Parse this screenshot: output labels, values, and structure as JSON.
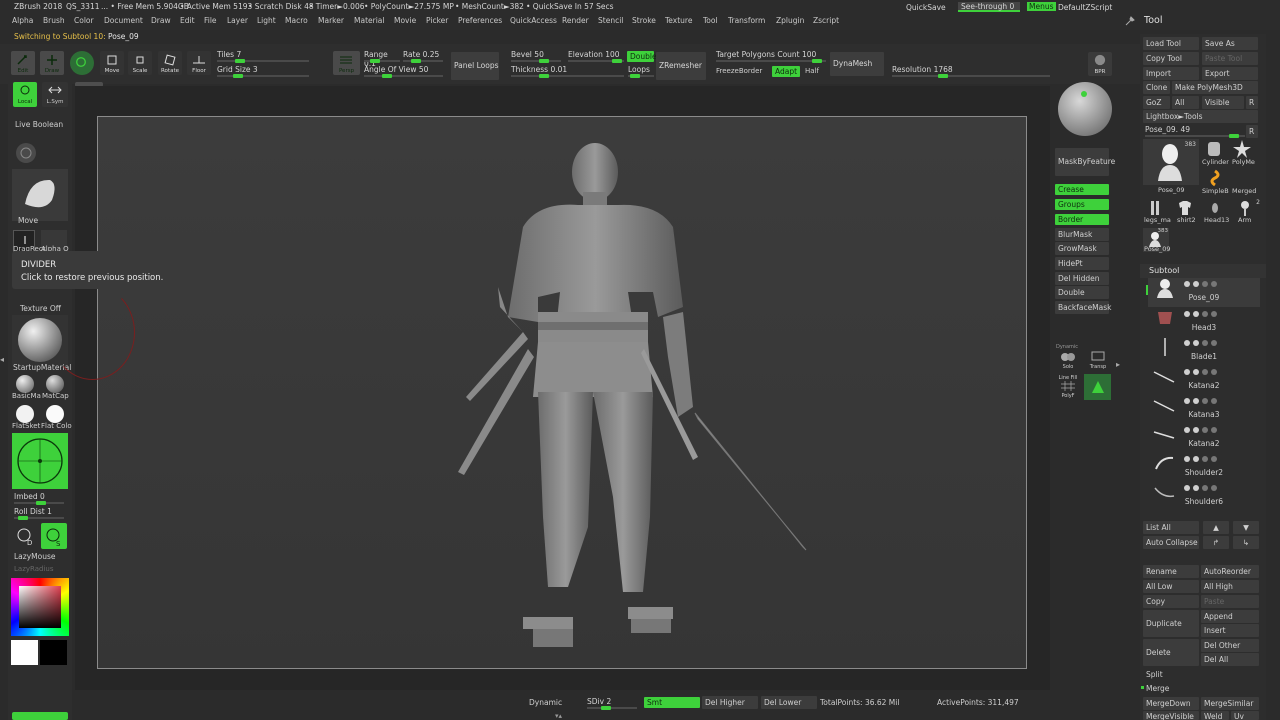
{
  "titlebar": {
    "app": "ZBrush 2018",
    "file": "QS_3311",
    "free_mem": "... • Free Mem 5.904GB",
    "active_mem": "• Active Mem 5193",
    "scratch": "• Scratch Disk 48",
    "timer": "• Timer►0.006",
    "polycount": "• PolyCount►27.575 MP",
    "meshcount": "• MeshCount►382",
    "quicksave_in": "• QuickSave In 57 Secs",
    "quicksave": "QuickSave",
    "see_through": "See-through  0",
    "menus": "Menus",
    "script": "DefaultZScript"
  },
  "menubar": [
    "Alpha",
    "Brush",
    "Color",
    "Document",
    "Draw",
    "Edit",
    "File",
    "Layer",
    "Light",
    "Macro",
    "Marker",
    "Material",
    "Movie",
    "Picker",
    "Preferences",
    "QuickAccess",
    "Render",
    "Stencil",
    "Stroke",
    "Texture",
    "Tool",
    "Transform",
    "Zplugin",
    "Zscript"
  ],
  "status": {
    "prefix": "Switching to Subtool 10:",
    "name": "Pose_09"
  },
  "toolbar": {
    "edit": "Edit",
    "draw": "Draw",
    "move": "Move",
    "scale": "Scale",
    "rotate": "Rotate",
    "floor": "Floor",
    "tiles_label": "Tiles",
    "tiles_val": "7",
    "grid_label": "Grid Size",
    "grid_val": "3",
    "persp": "Persp",
    "range_label": "Range",
    "range_val": "0.1",
    "rate_label": "Rate",
    "rate_val": "0.25",
    "angle_label": "Angle Of View",
    "angle_val": "50",
    "panel_loops": "Panel Loops",
    "bevel_label": "Bevel",
    "bevel_val": "50",
    "elevation_label": "Elevation",
    "elevation_val": "100",
    "double": "Double",
    "thickness_label": "Thickness",
    "thickness_val": "0.01",
    "loops": "Loops",
    "zremesher": "ZRemesher",
    "target_label": "Target Polygons Count",
    "target_val": "100",
    "freeze": "FreezeBorder",
    "adapt": "Adapt",
    "half": "Half",
    "dynamesh": "DynaMesh",
    "resolution_label": "Resolution",
    "resolution_val": "1768",
    "bpr": "BPR"
  },
  "left": {
    "local": "Local",
    "lsym": "L.Sym",
    "live_boolean": "Live Boolean",
    "move": "Move",
    "dragrect": "DragRect",
    "alpha": "Alpha O",
    "texture": "Texture Off",
    "startup_material": "StartupMaterial",
    "basic": "BasicMa",
    "matcap": "MatCap",
    "flat": "FlatSket",
    "flatcol": "Flat Colo",
    "imbed_label": "Imbed",
    "imbed_val": "0",
    "roll_label": "Roll Dist",
    "roll_val": "1",
    "lazymouse": "LazyMouse",
    "lazyradius": "LazyRadius"
  },
  "tooltip": {
    "title": "DIVIDER",
    "text": "Click to restore previous position."
  },
  "midright": {
    "maskbyfeature": "MaskByFeature",
    "crease": "Crease",
    "groups": "Groups",
    "border": "Border",
    "blurmask": "BlurMask",
    "growmask": "GrowMask",
    "hidept": "HidePt",
    "delhidden": "Del Hidden",
    "double": "Double",
    "backfacemask": "BackfaceMask",
    "solo": "Solo",
    "transp": "Transp",
    "polyf": "PolyF",
    "dynamic": "Dynamic",
    "linefill": "Line Fill"
  },
  "tool": {
    "title": "Tool",
    "load": "Load Tool",
    "save": "Save As",
    "copy": "Copy Tool",
    "paste": "Paste Tool",
    "import": "Import",
    "export": "Export",
    "clone": "Clone",
    "make_polymesh": "Make PolyMesh3D",
    "goz": "GoZ",
    "all": "All",
    "visible": "Visible",
    "r": "R",
    "lightbox": "Lightbox►Tools",
    "pose_label": "Pose_09.",
    "pose_val": "49",
    "thumb_count": "383",
    "thumbs": [
      {
        "name": "Pose_09"
      },
      {
        "name": "Cylinder"
      },
      {
        "name": "PolyMe"
      },
      {
        "name": "SimpleB"
      },
      {
        "name": "Merged"
      },
      {
        "name": "legs_ma"
      },
      {
        "name": "shirt2"
      },
      {
        "name": "Head13"
      },
      {
        "name": "Arm"
      },
      {
        "name": "Pose_09"
      }
    ],
    "thumb_small_count": "383",
    "thumb_arm_count": "2",
    "subtool_header": "Subtool",
    "subtools": [
      "Pose_09",
      "Head3",
      "Blade1",
      "Katana2",
      "Katana3",
      "Katana2",
      "Shoulder2",
      "Shoulder6"
    ],
    "list_all": "List All",
    "auto_collapse": "Auto Collapse",
    "rename": "Rename",
    "autoreorder": "AutoReorder",
    "all_low": "All Low",
    "all_high": "All High",
    "copy2": "Copy",
    "paste2": "Paste",
    "duplicate": "Duplicate",
    "append": "Append",
    "insert": "Insert",
    "delete": "Delete",
    "del_other": "Del Other",
    "del_all": "Del All",
    "split": "Split",
    "merge": "Merge",
    "mergedown": "MergeDown",
    "mergesimilar": "MergeSimilar",
    "mergevisible": "MergeVisible",
    "weld": "Weld",
    "uv": "Uv"
  },
  "bottom": {
    "dynamic": "Dynamic",
    "sdiv_label": "SDiv",
    "sdiv_val": "2",
    "smt": "Smt",
    "del_higher": "Del Higher",
    "del_lower": "Del Lower",
    "total_points": "TotalPoints: 36.62 Mil",
    "active_points": "ActivePoints: 311,497"
  },
  "colors": {
    "accent": "#3ed13b",
    "bg": "#2b2b2b",
    "canvas": "#3a3a3a"
  }
}
